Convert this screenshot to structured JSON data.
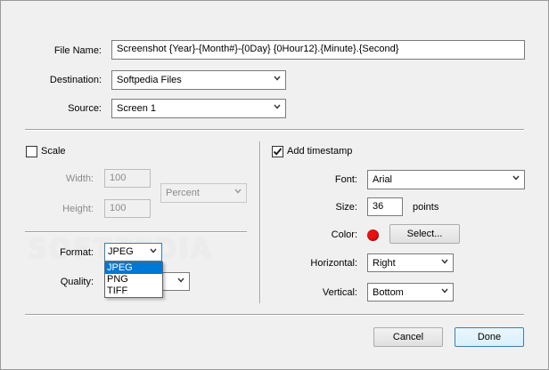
{
  "fields": {
    "file_name_label": "File Name:",
    "file_name_value": "Screenshot {Year}-{Month#}-{0Day} {0Hour12}.{Minute}.{Second}",
    "destination_label": "Destination:",
    "destination_value": "Softpedia Files",
    "source_label": "Source:",
    "source_value": "Screen 1"
  },
  "scale": {
    "checkbox_label": "Scale",
    "checked": false,
    "width_label": "Width:",
    "width_value": "100",
    "height_label": "Height:",
    "height_value": "100",
    "unit_value": "Percent"
  },
  "format": {
    "format_label": "Format:",
    "format_value": "JPEG",
    "quality_label": "Quality:",
    "options": [
      "JPEG",
      "PNG",
      "TIFF"
    ],
    "selected_option": "JPEG"
  },
  "timestamp": {
    "checkbox_label": "Add timestamp",
    "checked": true,
    "font_label": "Font:",
    "font_value": "Arial",
    "size_label": "Size:",
    "size_value": "36",
    "size_unit": "points",
    "color_label": "Color:",
    "color_value": "#e81010",
    "select_button": "Select...",
    "horizontal_label": "Horizontal:",
    "horizontal_value": "Right",
    "vertical_label": "Vertical:",
    "vertical_value": "Bottom"
  },
  "buttons": {
    "cancel": "Cancel",
    "done": "Done"
  },
  "watermark": "SOFTPEDIA"
}
